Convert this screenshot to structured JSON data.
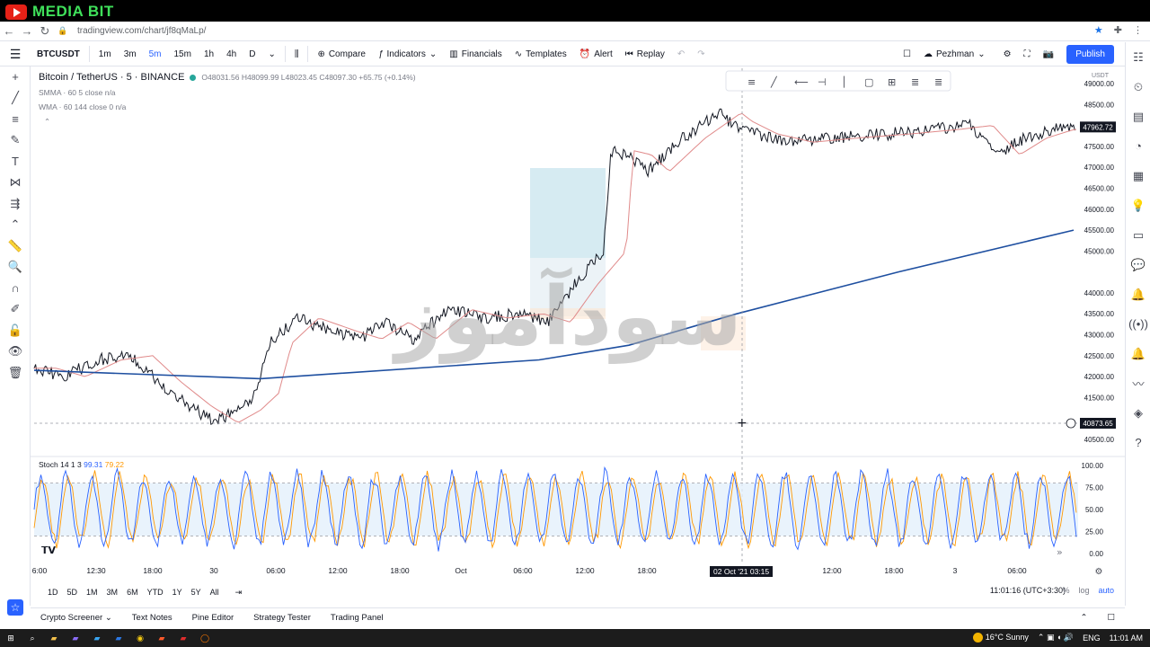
{
  "banner": {
    "brand": "MEDIA BIT"
  },
  "browser": {
    "url": "tradingview.com/chart/jf8qMaLp/"
  },
  "toolbar": {
    "symbol": "BTCUSDT",
    "intervals": [
      "1m",
      "3m",
      "5m",
      "15m",
      "1h",
      "4h",
      "D"
    ],
    "active_interval": "5m",
    "compare": "Compare",
    "indicators": "Indicators",
    "financials": "Financials",
    "templates": "Templates",
    "alert": "Alert",
    "replay": "Replay",
    "layout_name": "Pezhman",
    "publish": "Publish"
  },
  "legend": {
    "symbol_line": "Bitcoin / TetherUS · 5 · BINANCE",
    "ohlc": "O48031.56 H48099.99 L48023.45 C48097.30 +65.75 (+0.14%)",
    "smma": "SMMA · 60 5 close",
    "smma_val": "n/a",
    "wma": "WMA · 60 144 close 0",
    "wma_val": "n/a"
  },
  "price_axis": {
    "currency": "USDT",
    "ticks": [
      "49000.00",
      "48500.00",
      "47500.00",
      "47000.00",
      "46500.00",
      "46000.00",
      "45500.00",
      "45000.00",
      "44000.00",
      "43500.00",
      "43000.00",
      "42500.00",
      "42000.00",
      "41500.00",
      "40500.00"
    ],
    "last_price": "47962.72",
    "crosshair_price": "40873.65"
  },
  "stoch": {
    "label": "Stoch 14 1 3",
    "k": "99.31",
    "d": "79.22",
    "ticks": [
      "100.00",
      "75.00",
      "50.00",
      "25.00",
      "0.00"
    ]
  },
  "time_axis": {
    "ticks": [
      "6:00",
      "12:30",
      "18:00",
      "30",
      "06:00",
      "12:00",
      "18:00",
      "Oct",
      "06:00",
      "12:00",
      "18:00",
      "12:00",
      "18:00",
      "3",
      "06:00"
    ],
    "crosshair_time": "02 Oct '21   03:15"
  },
  "bottom": {
    "ranges": [
      "1D",
      "5D",
      "1M",
      "3M",
      "6M",
      "YTD",
      "1Y",
      "5Y",
      "All"
    ],
    "clock": "11:01:16 (UTC+3:30)",
    "pct": "%",
    "log": "log",
    "auto": "auto"
  },
  "panels": [
    "Crypto Screener",
    "Text Notes",
    "Pine Editor",
    "Strategy Tester",
    "Trading Panel"
  ],
  "taskbar": {
    "weather": "16°C  Sunny",
    "lang": "ENG",
    "time": "11:01 AM"
  },
  "watermark": "سودآموز",
  "colors": {
    "accent": "#2962ff",
    "wma": "#1e4fa0",
    "smma": "#e08a8a",
    "stoch_k": "#2962ff",
    "stoch_d": "#ff9800"
  }
}
